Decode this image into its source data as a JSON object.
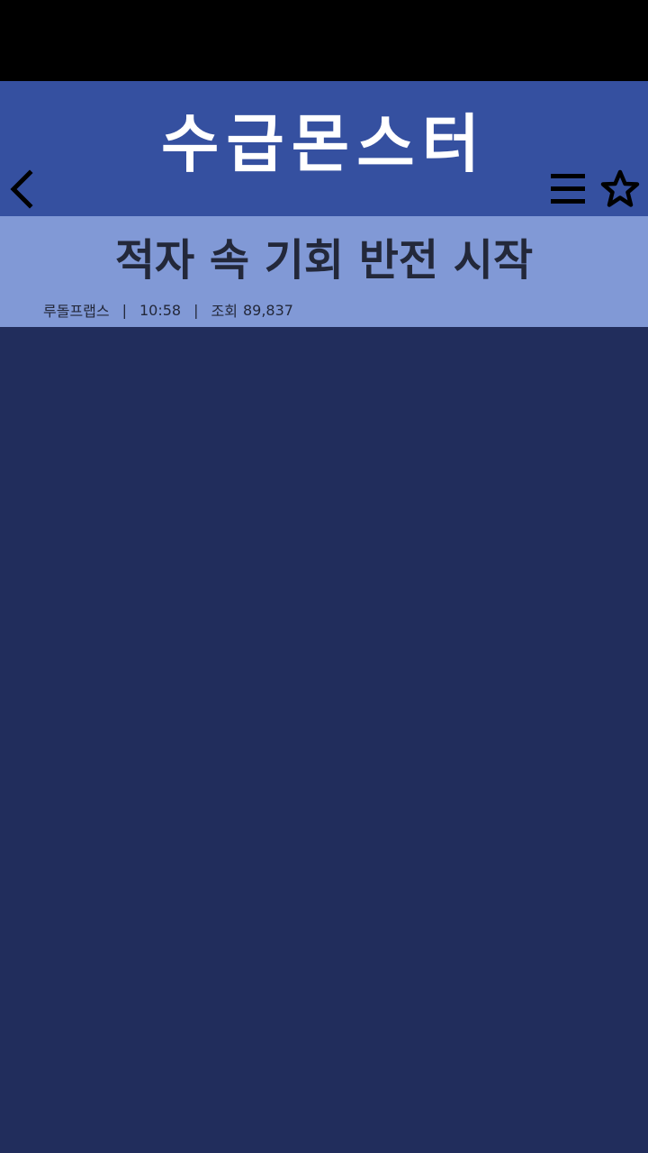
{
  "header": {
    "title": "수급몬스터",
    "back_icon": "chevron-left-icon",
    "menu_icon": "hamburger-menu-icon",
    "favorite_icon": "star-outline-icon"
  },
  "article": {
    "title": "적자 속 기회 반전 시작",
    "meta": {
      "author": "루돌프랩스",
      "separator": "|",
      "time": "10:58",
      "views_label": "조회",
      "views": "89,837"
    }
  },
  "colors": {
    "status_bar": "#000000",
    "header_bg": "#3550a0",
    "article_header_bg": "#8199d6",
    "content_bg": "#212d5c",
    "title_text": "#ffffff",
    "article_text": "#23283a"
  }
}
